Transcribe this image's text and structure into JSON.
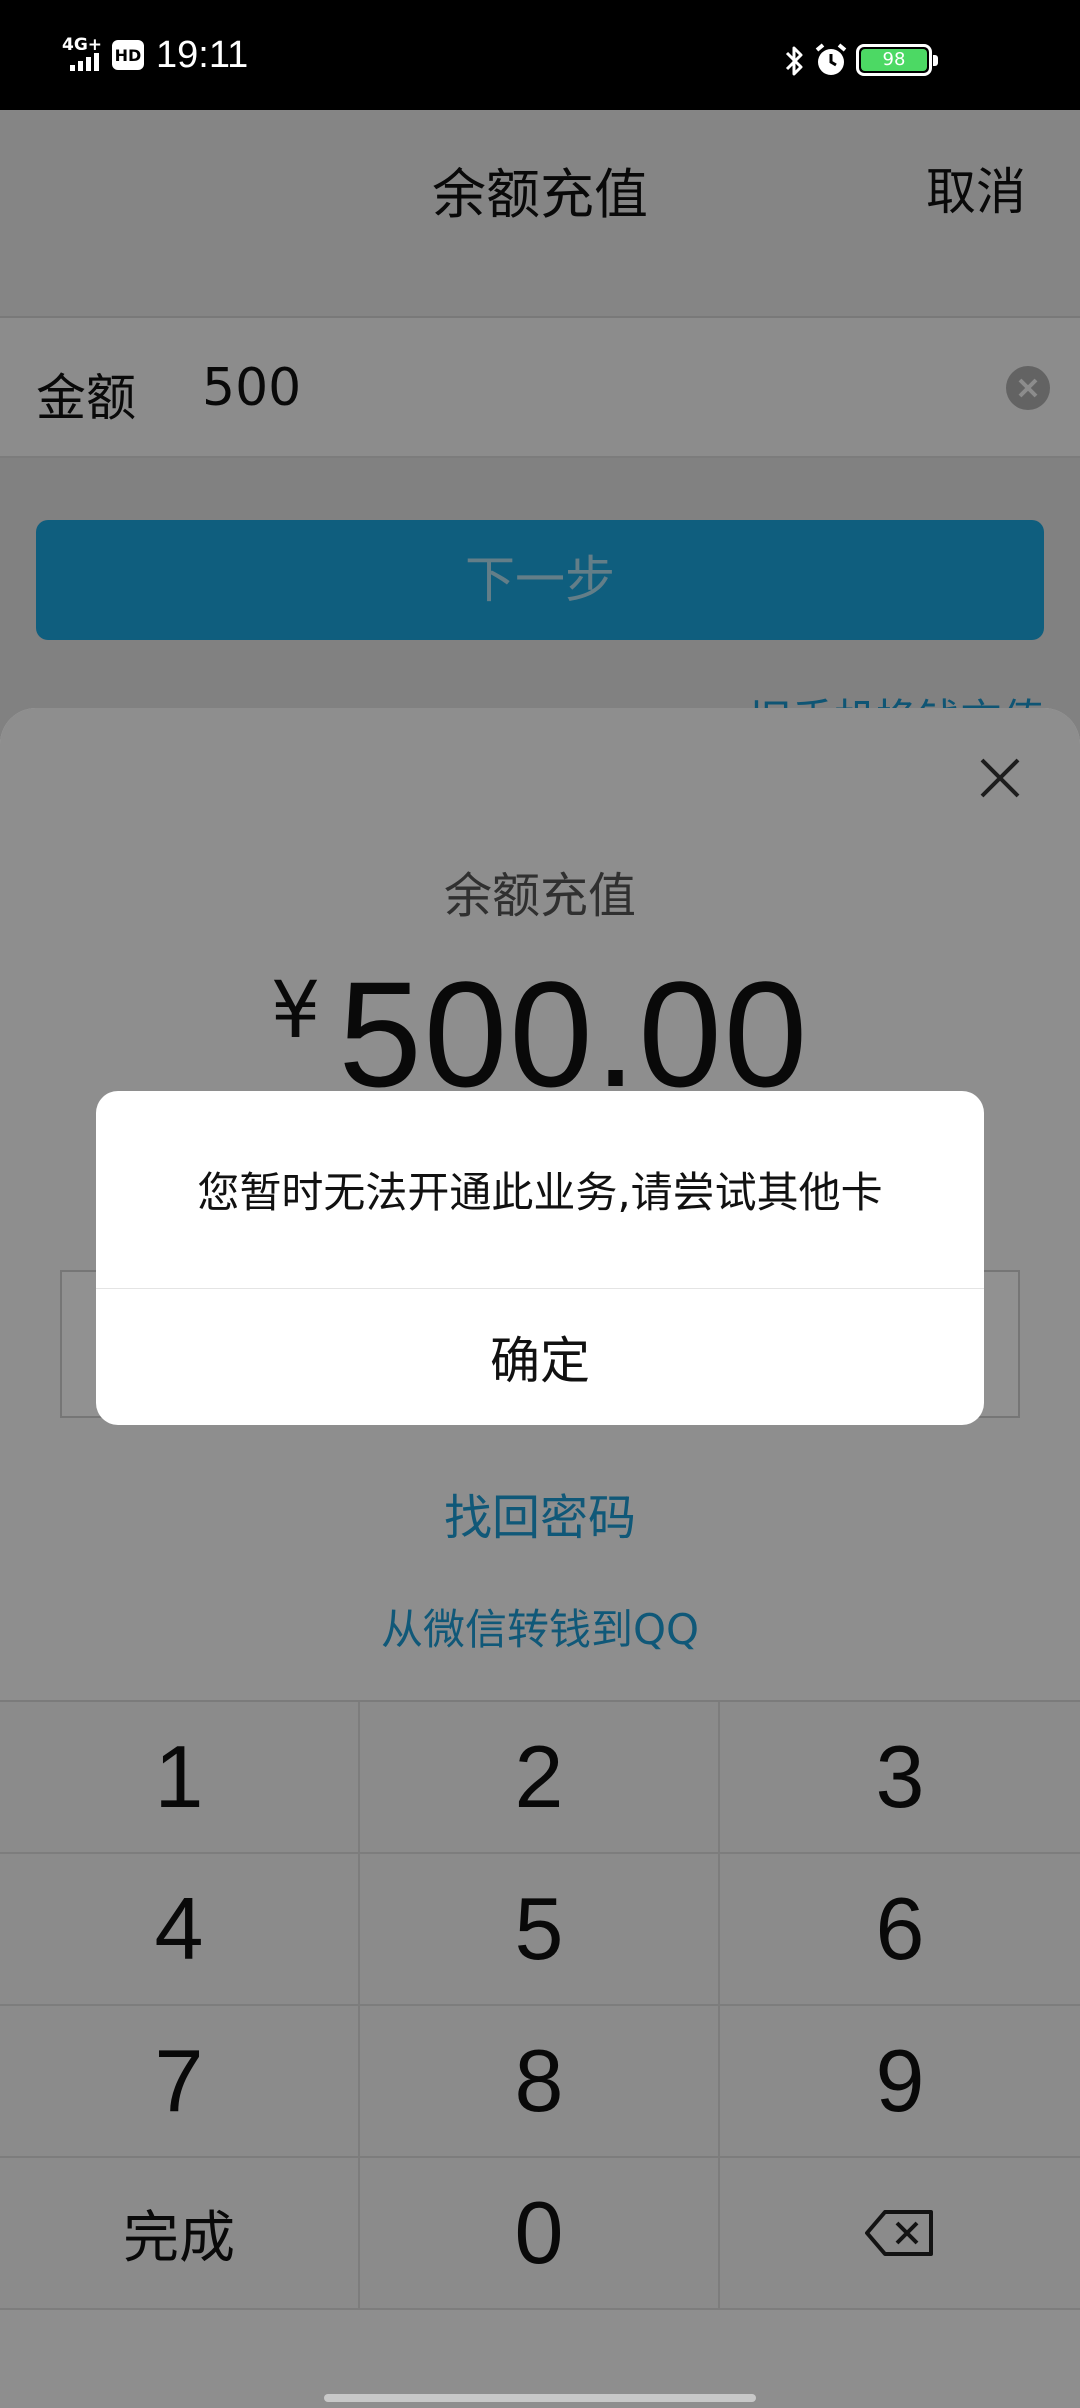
{
  "status_bar": {
    "network": "4G+",
    "hd": "HD",
    "time": "19:11",
    "battery_level": "98",
    "battery_color": "#4cd964"
  },
  "header": {
    "title": "余额充值",
    "cancel_label": "取消"
  },
  "amount_row": {
    "label": "金额",
    "value": "500"
  },
  "next_button": {
    "label": "下一步"
  },
  "link_behind": "旧手机换钱充值",
  "sheet": {
    "title": "余额充值",
    "currency": "¥",
    "amount": "500.00",
    "forgot_password": "找回密码",
    "wechat_transfer": "从微信转钱到QQ"
  },
  "keypad": {
    "keys": [
      "1",
      "2",
      "3",
      "4",
      "5",
      "6",
      "7",
      "8",
      "9",
      "完成",
      "0"
    ]
  },
  "dialog": {
    "message": "您暂时无法开通此业务,请尝试其他卡",
    "confirm_label": "确定"
  },
  "colors": {
    "accent": "#1d9bd3",
    "button": "#1dabe6"
  }
}
